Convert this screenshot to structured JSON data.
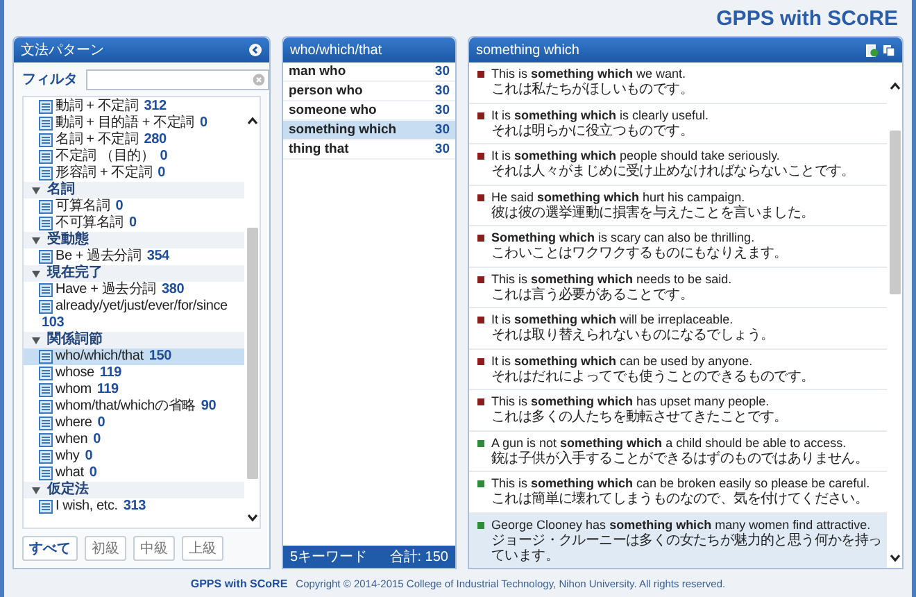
{
  "header": {
    "title": "GPPS with SCoRE"
  },
  "pattern_panel": {
    "title": "文法パターン",
    "filter_label": "フィルタ",
    "tree": [
      {
        "label": "動詞 + 不定詞",
        "count": "312",
        "selected": false
      },
      {
        "label": "動詞 + 目的語 + 不定詞",
        "count": "0",
        "selected": false
      },
      {
        "label": "名詞 + 不定詞",
        "count": "280",
        "selected": false
      },
      {
        "label": "不定詞 （目的）",
        "count": "0",
        "selected": false
      },
      {
        "label": "形容詞 + 不定詞",
        "count": "0",
        "selected": false
      },
      {
        "label": "名詞",
        "expanded": true,
        "children": [
          {
            "label": "可算名詞",
            "count": "0",
            "selected": false
          },
          {
            "label": "不可算名詞",
            "count": "0",
            "selected": false
          }
        ]
      },
      {
        "label": "受動態",
        "expanded": true,
        "children": [
          {
            "label": "Be + 過去分詞",
            "count": "354",
            "selected": false
          }
        ]
      },
      {
        "label": "現在完了",
        "expanded": true,
        "children": [
          {
            "label": "Have + 過去分詞",
            "count": "380",
            "selected": false
          },
          {
            "label": "already/yet/just/ever/for/since",
            "count": "103",
            "selected": false
          }
        ]
      },
      {
        "label": "関係詞節",
        "expanded": true,
        "children": [
          {
            "label": "who/which/that",
            "count": "150",
            "selected": true
          },
          {
            "label": "whose",
            "count": "119",
            "selected": false
          },
          {
            "label": "whom",
            "count": "119",
            "selected": false
          },
          {
            "label": "whom/that/whichの省略",
            "count": "90",
            "selected": false
          },
          {
            "label": "where",
            "count": "0",
            "selected": false
          },
          {
            "label": "when",
            "count": "0",
            "selected": false
          },
          {
            "label": "why",
            "count": "0",
            "selected": false
          },
          {
            "label": "what",
            "count": "0",
            "selected": false
          }
        ]
      },
      {
        "label": "仮定法",
        "expanded": true,
        "children": [
          {
            "label": "I wish, etc.",
            "count": "313",
            "selected": false
          }
        ]
      }
    ],
    "levels": [
      {
        "label": "すべて",
        "selected": true
      },
      {
        "label": "初級",
        "selected": false
      },
      {
        "label": "中級",
        "selected": false
      },
      {
        "label": "上級",
        "selected": false
      }
    ]
  },
  "keyword_panel": {
    "title": "who/which/that",
    "keywords": [
      {
        "label": "man who",
        "count": "30",
        "selected": false
      },
      {
        "label": "person who",
        "count": "30",
        "selected": false
      },
      {
        "label": "someone who",
        "count": "30",
        "selected": false
      },
      {
        "label": "something which",
        "count": "30",
        "selected": true
      },
      {
        "label": "thing that",
        "count": "30",
        "selected": false
      }
    ],
    "summary": "5キーワード",
    "total": "合計: 150"
  },
  "sentence_panel": {
    "title": "something which",
    "sentences": [
      {
        "english": "This is **something which** we want.",
        "japanese": "これは私たちがほしいものです。",
        "color": "#8b1c1c",
        "selected": false
      },
      {
        "english": "It is **something which** is clearly useful.",
        "japanese": "それは明らかに役立つものです。",
        "color": "#8b1c1c",
        "selected": false
      },
      {
        "english": "It is **something which** people should take seriously.",
        "japanese": "それは人々がまじめに受け止めなければならないことです。",
        "color": "#8b1c1c",
        "selected": false
      },
      {
        "english": "He said **something which** hurt his campaign.",
        "japanese": "彼は彼の選挙運動に損害を与えたことを言いました。",
        "color": "#8b1c1c",
        "selected": false
      },
      {
        "english": "**Something which** is scary can also be thrilling.",
        "japanese": "こわいことはワクワクするものにもなりえます。",
        "color": "#8b1c1c",
        "selected": false
      },
      {
        "english": "This is **something which** needs to be said.",
        "japanese": "これは言う必要があることです。",
        "color": "#8b1c1c",
        "selected": false
      },
      {
        "english": "It is **something which** will be irreplaceable.",
        "japanese": "それは取り替えられないものになるでしょう。",
        "color": "#8b1c1c",
        "selected": false
      },
      {
        "english": "It is **something which** can be used by anyone.",
        "japanese": "それはだれによってでも使うことのできるものです。",
        "color": "#8b1c1c",
        "selected": false
      },
      {
        "english": "This is **something which** has upset many people.",
        "japanese": "これは多くの人たちを動転させてきたことです。",
        "color": "#8b1c1c",
        "selected": false
      },
      {
        "english": "A gun is not **something which** a child should be able to access.",
        "japanese": "銃は子供が入手することができるはずのものではありません。",
        "color": "#2e8b3a",
        "selected": false
      },
      {
        "english": "This is **something which** can be broken easily so please be careful.",
        "japanese": "これは簡単に壊れてしまうものなので、気を付けてください。",
        "color": "#2e8b3a",
        "selected": false
      },
      {
        "english": "George Clooney has **something which** many women find attractive.",
        "japanese": "ジョージ・クルーニーは多くの女たちが魅力的と思う何かを持っています。",
        "color": "#2e8b3a",
        "selected": true
      }
    ]
  },
  "footer": {
    "brand": "GPPS with SCoRE",
    "copyright": "Copyright © 2014-2015 College of Industrial Technology, Nihon University. All rights reserved."
  }
}
